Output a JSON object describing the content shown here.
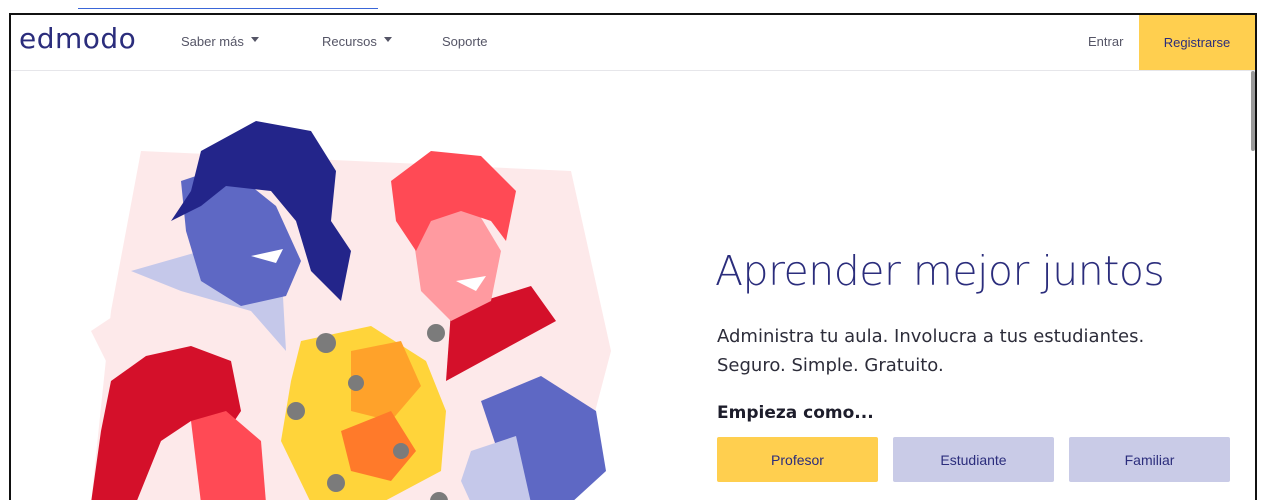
{
  "nav": {
    "logo": "edmodo",
    "items": [
      {
        "label": "Saber más"
      },
      {
        "label": "Recursos"
      },
      {
        "label": "Soporte"
      }
    ],
    "login": "Entrar",
    "signup": "Registrarse"
  },
  "hero": {
    "title": "Aprender mejor juntos",
    "subtitle_line1": "Administra tu aula. Involucra a tus estudiantes.",
    "subtitle_line2": "Seguro. Simple. Gratuito.",
    "start_label": "Empieza como...",
    "buttons": [
      {
        "label": "Profesor"
      },
      {
        "label": "Estudiante"
      },
      {
        "label": "Familiar"
      }
    ]
  },
  "colors": {
    "brand": "#2b2d7c",
    "accent": "#ffcf4f",
    "secondary_button": "#c9cbe7"
  },
  "illustration": {
    "icon": "students-lightbulbs-illustration"
  }
}
